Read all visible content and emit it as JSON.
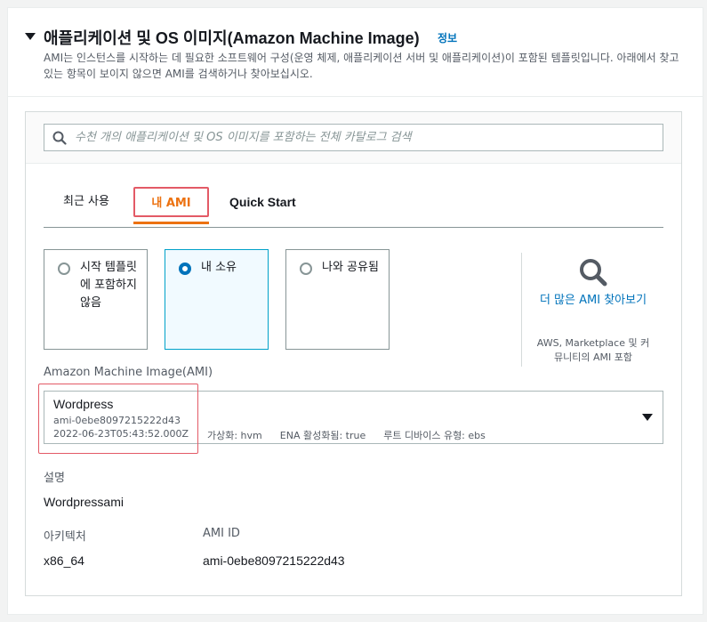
{
  "section": {
    "title": "애플리케이션 및 OS 이미지(Amazon Machine Image)",
    "info_link": "정보",
    "description": "AMI는 인스턴스를 시작하는 데 필요한 소프트웨어 구성(운영 체제, 애플리케이션 서버 및 애플리케이션)이 포함된 템플릿입니다. 아래에서 찾고 있는 항목이 보이지 않으면 AMI를 검색하거나 찾아보십시오."
  },
  "search": {
    "placeholder": "수천 개의 애플리케이션 및 OS 이미지를 포함하는 전체 카탈로그 검색",
    "value": "",
    "icon": "search-icon"
  },
  "tabs": [
    {
      "label": "최근 사용",
      "active": false
    },
    {
      "label": "내 AMI",
      "active": true
    },
    {
      "label": "Quick Start",
      "active": false
    }
  ],
  "ownership_options": [
    {
      "label": "시작 템플릿에 포함하지 않음",
      "checked": false
    },
    {
      "label": "내 소유",
      "checked": true
    },
    {
      "label": "나와 공유됨",
      "checked": false
    }
  ],
  "browse_more": {
    "link": "더 많은 AMI 찾아보기",
    "subtext": "AWS, Marketplace 및 커뮤니티의 AMI 포함",
    "icon": "magnifier-icon"
  },
  "ami": {
    "label": "Amazon Machine Image(AMI)",
    "selected": {
      "name": "Wordpress",
      "id": "ami-0ebe8097215222d43",
      "date": "2022-06-23T05:43:52.000Z",
      "virtualization": "가상화: hvm",
      "ena": "ENA 활성화됨: true",
      "root_device": "루트 디바이스 유형: ebs"
    }
  },
  "details": {
    "description_label": "설명",
    "description_value": "Wordpressami",
    "arch_label": "아키텍처",
    "arch_value": "x86_64",
    "ami_id_label": "AMI ID",
    "ami_id_value": "ami-0ebe8097215222d43"
  },
  "colors": {
    "accent_orange": "#ec7211",
    "link_blue": "#0073bb",
    "selected_border": "#00a1c9",
    "highlight_red": "#e35a66"
  }
}
